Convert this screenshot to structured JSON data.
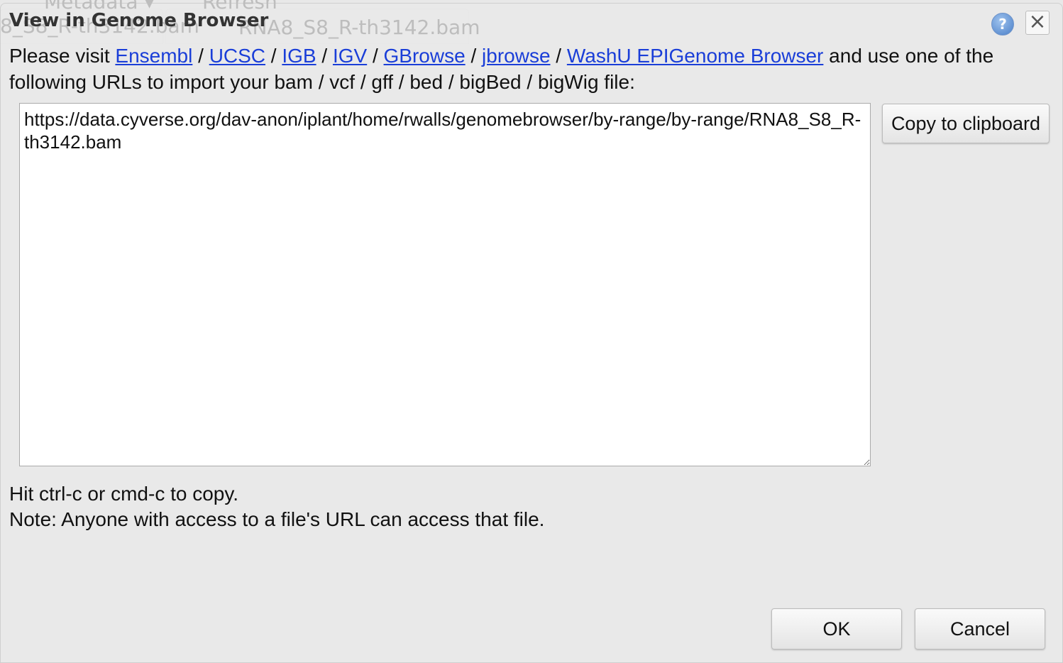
{
  "background": {
    "metadata_label": "Metadata ▾",
    "refresh_label": "Refresh",
    "tab_1": "8_S8_R-th3142.bam",
    "tab_2": "RNA8_S8_R-th3142.bam"
  },
  "dialog": {
    "title": "View in Genome Browser",
    "help_icon": "question-circle-icon",
    "close_icon": "x-icon",
    "intro_prefix": "Please visit ",
    "links": [
      "Ensembl",
      "UCSC",
      "IGB",
      "IGV",
      "GBrowse",
      "jbrowse",
      "WashU EPIGenome Browser"
    ],
    "separator": " / ",
    "intro_suffix": " and use one of the following URLs to import your bam / vcf / gff / bed / bigBed / bigWig file:",
    "url_value": "https://data.cyverse.org/dav-anon/iplant/home/rwalls/genomebrowser/by-range/by-range/RNA8_S8_R-th3142.bam",
    "copy_button": "Copy to clipboard",
    "hint": "Hit ctrl-c or cmd-c to copy.",
    "note": "Note: Anyone with access to a file's URL can access that file.",
    "ok_button": "OK",
    "cancel_button": "Cancel",
    "link_color": "#1a3ed8"
  }
}
